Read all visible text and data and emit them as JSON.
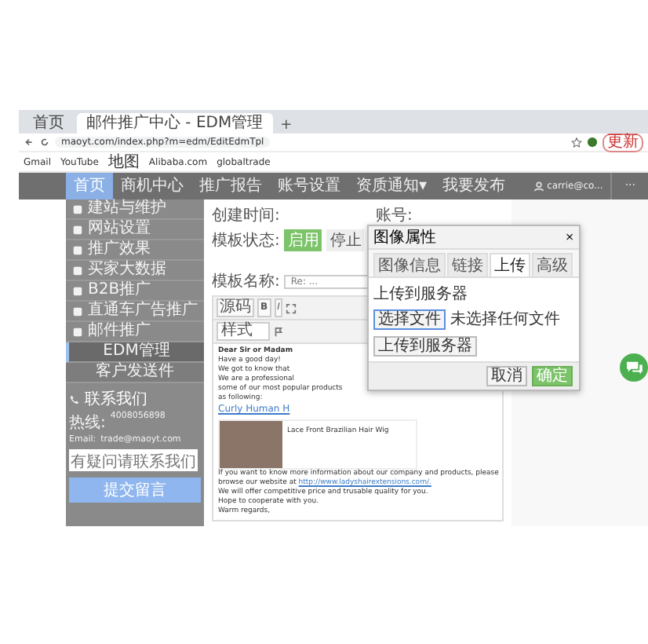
{
  "browser": {
    "tabs": [
      {
        "title": "首页",
        "selected": false
      },
      {
        "title": "邮件推广中心 - EDM管理",
        "selected": true
      }
    ],
    "new_tab": "+",
    "address": "maoyt.com/index.php?m=edm/EditEdmTpl",
    "bookmarks": [
      "Gmail",
      "YouTube",
      "地图",
      "Alibaba.com",
      "globaltrade"
    ],
    "update": "更新"
  },
  "nav": {
    "items": [
      {
        "label": "首页",
        "selected": true
      },
      {
        "label": "商机中心",
        "selected": false
      },
      {
        "label": "推广报告",
        "selected": false
      },
      {
        "label": "账号设置",
        "selected": false
      },
      {
        "label": "资质通知▾",
        "selected": false
      },
      {
        "label": "我要发布",
        "selected": false
      }
    ],
    "user": "carrie@co...",
    "more": "···"
  },
  "sidebar": {
    "items": [
      {
        "kind": "main",
        "label": "建站与维护",
        "selected": false
      },
      {
        "kind": "main",
        "label": "网站设置",
        "selected": false
      },
      {
        "kind": "main",
        "label": "推广效果",
        "selected": false
      },
      {
        "kind": "main",
        "label": "买家大数据",
        "selected": false
      },
      {
        "kind": "main",
        "label": "B2B推广",
        "selected": false
      },
      {
        "kind": "main",
        "label": "直通车广告推广",
        "selected": false
      },
      {
        "kind": "main",
        "label": "邮件推广",
        "selected": false
      },
      {
        "kind": "sub",
        "label": "EDM管理",
        "selected": true
      },
      {
        "kind": "sub",
        "label": "客户发送件",
        "selected": false
      }
    ],
    "contact": {
      "title": "联系我们",
      "phone_label": "热线:",
      "phone": "4008056898",
      "email_label": "Email:",
      "email": "trade@maoyt.com",
      "message_placeholder": "有疑问请联系我们",
      "submit": "提交留言"
    }
  },
  "form": {
    "created_label": "创建时间:",
    "account_label": "账号:",
    "status_label": "模板状态:",
    "status_options": [
      {
        "label": "启用",
        "selected": true
      },
      {
        "label": "停止",
        "selected": false
      }
    ],
    "name_label": "模板名称:",
    "name_value": "Re: ..."
  },
  "editor": {
    "source": "源码",
    "bold": "B",
    "italic": "I",
    "style_select": "样式",
    "greeting": "Dear Sir or Madam",
    "intro_lines": [
      "Have a good day!",
      "We got to know that",
      "We are a professional"
    ],
    "intro_tail": "some of our most popular products as following:",
    "product_link": "Curly Human H",
    "product_caption": "Lace Front Brazilian Hair Wig",
    "closing_text": "If you want to know more information about our company and products, please browse our website at",
    "website_link": "http://www.ladyshairextensions.com/.",
    "closing_lines": [
      "We will offer competitive price and trusable quality for you.",
      "Hope to cooperate with you.",
      "Warm regards,"
    ]
  },
  "dialog": {
    "title": "图像属性",
    "close": "×",
    "tabs": [
      {
        "label": "图像信息",
        "selected": false
      },
      {
        "label": "链接",
        "selected": false
      },
      {
        "label": "上传",
        "selected": true
      },
      {
        "label": "高级",
        "selected": false
      }
    ],
    "upload_label": "上传到服务器",
    "choose_file": "选择文件",
    "no_file": "未选择任何文件",
    "upload_button": "上传到服务器",
    "cancel": "取消",
    "ok": "确定"
  }
}
